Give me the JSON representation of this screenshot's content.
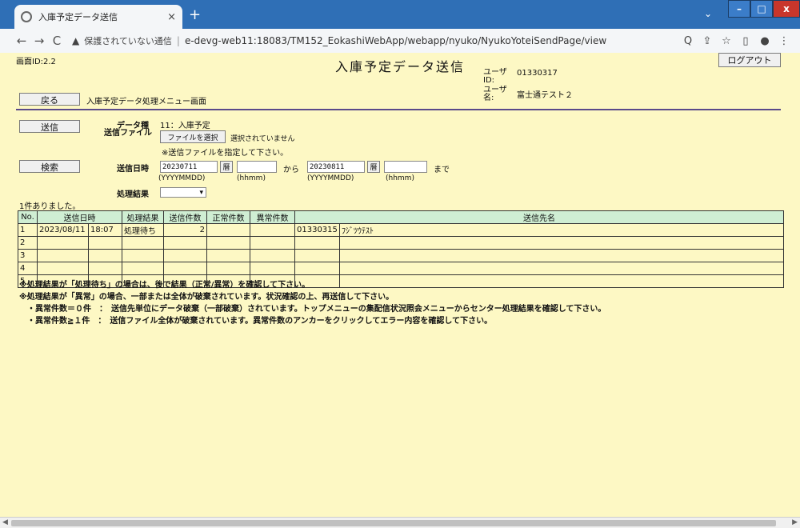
{
  "browser": {
    "tab_title": "入庫予定データ送信",
    "tab_close": "×",
    "new_tab": "+",
    "address_warning": "保護されていない通信",
    "address_sep": "|",
    "url": "e-devg-web11:18083/TM152_EokashiWebApp/webapp/nyuko/NyukoYoteiSendPage/view",
    "back": "←",
    "forward": "→",
    "reload": "C",
    "zoom": "Q",
    "share": "⇪",
    "star": "☆",
    "menu": "⋮",
    "chevron": "⌄",
    "win_min": "–",
    "win_max": "□",
    "win_close": "x"
  },
  "header": {
    "screen_id": "画面ID:2.2",
    "title": "入庫予定データ送信",
    "logout": "ログアウト",
    "user_id_label": "ユーザID:",
    "user_id_value": "01330317",
    "user_name_label": "ユーザ名:",
    "user_name_value": "富士通テスト２"
  },
  "nav": {
    "back_button": "戻る",
    "back_menu_label": "入庫予定データ処理メニュー画面"
  },
  "send": {
    "button": "送信",
    "data_type_label": "データ種",
    "data_type_value": "11：入庫予定",
    "file_label": "送信ファイル",
    "file_button": "ファイルを選択",
    "file_status": "選択されていません",
    "file_hint": "※送信ファイルを指定して下さい。"
  },
  "search": {
    "button": "検索",
    "datetime_label": "送信日時",
    "from_date": "20230711",
    "from_time": "",
    "range_from": "から",
    "to_date": "20230811",
    "to_time": "",
    "range_to": "まで",
    "cal_icon": "曆",
    "date_format": "(YYYYMMDD)",
    "time_format": "(hhmm)",
    "result_label": "処理結果",
    "result_selected": "▾",
    "found_message": "1件ありました。"
  },
  "table": {
    "headers": [
      "No.",
      "送信日時",
      "処理結果",
      "送信件数",
      "正常件数",
      "異常件数",
      "送信先名"
    ],
    "rows": [
      [
        "1",
        "2023/08/11",
        "18:07",
        "処理待ち",
        "2",
        "",
        "",
        "01330315",
        "ﾌｼﾞﾂｳﾃｽﾄ"
      ],
      [
        "2",
        "",
        "",
        "",
        "",
        "",
        "",
        "",
        ""
      ],
      [
        "3",
        "",
        "",
        "",
        "",
        "",
        "",
        "",
        ""
      ],
      [
        "4",
        "",
        "",
        "",
        "",
        "",
        "",
        "",
        ""
      ],
      [
        "5",
        "",
        "",
        "",
        "",
        "",
        "",
        "",
        ""
      ]
    ]
  },
  "notes": [
    "※処理結果が「処理待ち」の場合は、後で結果（正常/異常）を確認して下さい。",
    "※処理結果が「異常」の場合、一部または全体が破棄されています。状況確認の上、再送信して下さい。",
    "　・異常件数＝０件　：　送信先単位にデータ破棄（一部破棄）されています。トップメニューの集配信状況照会メニューからセンター処理結果を確認して下さい。",
    "　・異常件数≧１件　：　送信ファイル全体が破棄されています。異常件数のアンカーをクリックしてエラー内容を確認して下さい。"
  ],
  "colors": {
    "page_bg": "#fdf8c4",
    "table_header_bg": "#cfeed3",
    "divider": "#5a4a8a",
    "titlebar": "#2f6fb6"
  }
}
